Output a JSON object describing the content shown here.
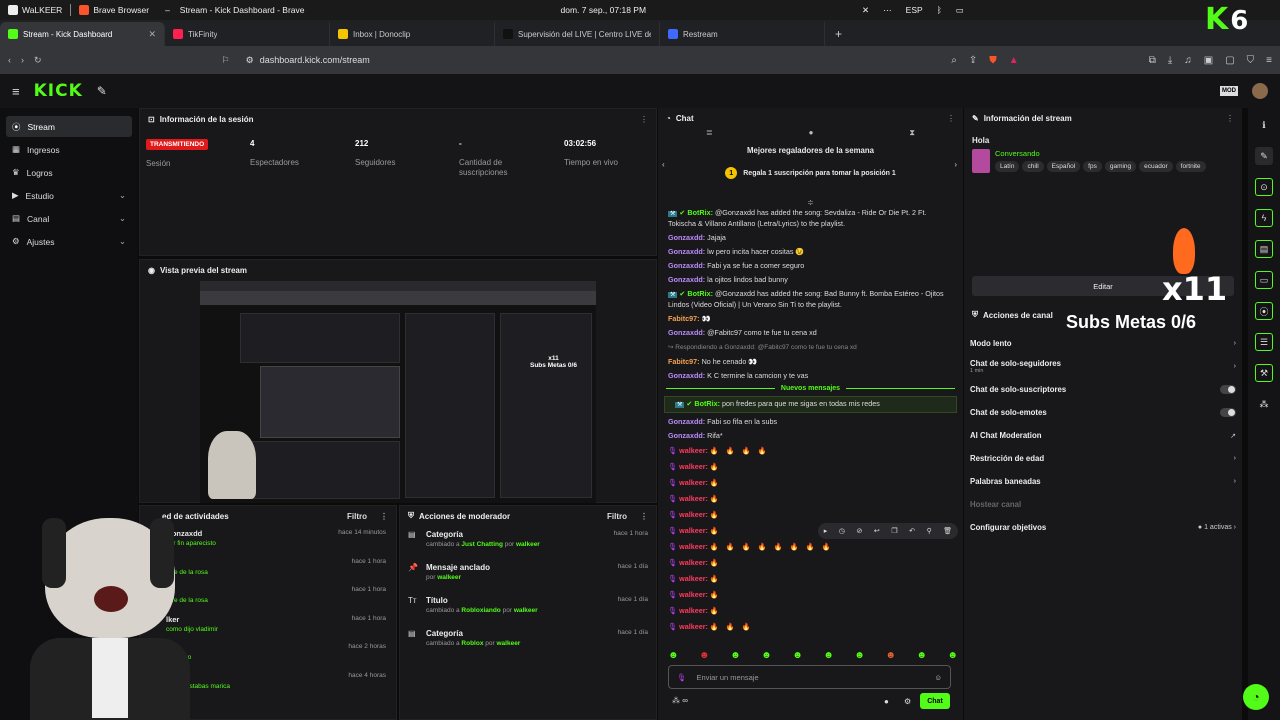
{
  "system": {
    "app": "WaLKEER",
    "browser": "Brave Browser",
    "window_title": "Stream - Kick Dashboard - Brave",
    "clock": "dom. 7 sep., 07:18 PM",
    "lang": "ESP"
  },
  "tabs": [
    {
      "label": "Stream - Kick Dashboard",
      "color": "#53fc18"
    },
    {
      "label": "TikFinity",
      "color": "#ff2050"
    },
    {
      "label": "Inbox | Donoclip",
      "color": "#f5c400"
    },
    {
      "label": "Supervisión del LIVE | Centro LIVE de",
      "color": "#111"
    },
    {
      "label": "Restream",
      "color": "#3d6bff"
    }
  ],
  "url": "dashboard.kick.com/stream",
  "logo": "KICK",
  "sidebar": [
    {
      "label": "Stream"
    },
    {
      "label": "Ingresos"
    },
    {
      "label": "Logros"
    },
    {
      "label": "Estudio"
    },
    {
      "label": "Canal"
    },
    {
      "label": "Ajustes"
    }
  ],
  "session": {
    "title": "Información de la sesión",
    "live_badge": "TRANSMITIENDO",
    "session_label": "Sesión",
    "viewers": "4",
    "viewers_label": "Espectadores",
    "followers": "212",
    "followers_label": "Seguidores",
    "subs": "-",
    "subs_label": "Cantidad de suscripciones",
    "time": "03:02:56",
    "time_label": "Tiempo en vivo"
  },
  "preview": {
    "title": "Vista previa del stream"
  },
  "activity": {
    "title": "ed de actividades",
    "filter": "Filtro",
    "rows": [
      {
        "user": "Gonzaxdd",
        "detail": "por fin aparecisto",
        "time": "hace 14 minutos"
      },
      {
        "user": "er",
        "detail": "Aire de la rosa",
        "time": "hace 1 hora"
      },
      {
        "user": "er",
        "detail": "Aire de la rosa",
        "time": "hace 1 hora"
      },
      {
        "user": "lker",
        "detail": "como dijo vladimir",
        "time": "hace 1 hora"
      },
      {
        "user": "er",
        "detail": "El huevo",
        "time": "hace 2 horas"
      },
      {
        "user": "er",
        "detail": "donde estabas marica",
        "time": "hace 4 horas"
      }
    ]
  },
  "mod": {
    "title": "Acciones de moderador",
    "filter": "Filtro",
    "rows": [
      {
        "icon": "▤",
        "title": "Categoría",
        "pre": "cambiado a",
        "value": "Just Chatting",
        "by": "por",
        "user": "walkeer",
        "time": "hace 1 hora"
      },
      {
        "icon": "📌",
        "title": "Mensaje anclado",
        "pre": "",
        "value": "",
        "by": "por",
        "user": "walkeer",
        "time": "hace 1 día"
      },
      {
        "icon": "Tт",
        "title": "Título",
        "pre": "cambiado a",
        "value": "Robloxiando",
        "by": "por",
        "user": "walkeer",
        "time": "hace 1 día"
      },
      {
        "icon": "▤",
        "title": "Categoría",
        "pre": "cambiado a",
        "value": "Roblox",
        "by": "por",
        "user": "walkeer",
        "time": "hace 1 día"
      }
    ]
  },
  "chat": {
    "title": "Chat",
    "gifters_title": "Mejores regaladores de la semana",
    "gifters_rank": "1",
    "gifters_cta": "Regala 1 suscripción para tomar la posición 1",
    "new_messages": "Nuevos mensajes",
    "input_placeholder": "Enviar un mensaje",
    "send": "Chat",
    "messages": [
      {
        "user": "BotRix:",
        "cls": "ug",
        "bot": true,
        "text": "@Gonzaxdd has added the song: Sevdaliza - Ride Or Die Pt. 2 Ft. Tokischa & Villano Antillano (Letra/Lyrics) to the playlist."
      },
      {
        "user": "Gonzaxdd:",
        "cls": "u1",
        "text": "Jajaja"
      },
      {
        "user": "Gonzaxdd:",
        "cls": "u1",
        "text": "lw pero incita hacer cositas 😉"
      },
      {
        "user": "Gonzaxdd:",
        "cls": "u1",
        "text": "Fabi ya se fue a comer seguro"
      },
      {
        "user": "Gonzaxdd:",
        "cls": "u1",
        "text": "la ojitos lindos bad bunny"
      },
      {
        "user": "BotRix:",
        "cls": "ug",
        "bot": true,
        "text": "@Gonzaxdd has added the song: Bad Bunny ft. Bomba Estéreo - Ojitos Lindos (Video Oficial) | Un Verano Sin Ti to the playlist."
      },
      {
        "user": "Fabitc97:",
        "cls": "u2",
        "text": "👀"
      },
      {
        "user": "Gonzaxdd:",
        "cls": "u1",
        "text": "@Fabitc97 como te fue tu cena xd"
      },
      {
        "user": "↪ Respondiendo a Gonzaxdd: @Fabitc97 como te fue tu cena xd",
        "cls": "reply",
        "text": ""
      },
      {
        "user": "Fabitc97:",
        "cls": "u2",
        "text": "No he cenado 👀"
      },
      {
        "user": "Gonzaxdd:",
        "cls": "u1",
        "text": "K C termine la camcion y te vas"
      }
    ],
    "messages_after": [
      {
        "user": "BotRix:",
        "cls": "ug",
        "bot": true,
        "text": "pon fredes para que me sigas en todas mis redes"
      },
      {
        "user": "Gonzaxdd:",
        "cls": "u1",
        "text": "Fabi so fifa en la subs"
      },
      {
        "user": "Gonzaxdd:",
        "cls": "u1",
        "text": "Rifa*"
      }
    ],
    "walkeer": "walkeer:",
    "flames": [
      4,
      1,
      1,
      1,
      1,
      1,
      8,
      1,
      1,
      1,
      1,
      3
    ]
  },
  "overlay": {
    "x": "x11",
    "subs": "Subs Metas 0/6",
    "kick": "K",
    "kick_num": "6"
  },
  "stream_info": {
    "title": "Información del stream",
    "stream_title": "Hola",
    "category": "Conversando",
    "tags": [
      "Latín",
      "chill",
      "Español",
      "fps",
      "gaming",
      "ecuador",
      "fortnite"
    ],
    "edit": "Editar"
  },
  "channel_actions": {
    "title": "Acciones de canal",
    "rows": [
      {
        "label": "Modo lento",
        "right": "›"
      },
      {
        "label": "Chat de solo-seguidores",
        "sub": "1 min",
        "right": "›"
      },
      {
        "label": "Chat de solo-suscriptores",
        "toggle": true
      },
      {
        "label": "Chat de solo-emotes",
        "toggle": true
      },
      {
        "label": "AI Chat Moderation",
        "right": "↗"
      },
      {
        "label": "Restricción de edad",
        "right": "›"
      },
      {
        "label": "Palabras baneadas",
        "right": "›"
      },
      {
        "label": "Hostear canal",
        "muted": true
      },
      {
        "label": "Configurar objetivos",
        "right": "● 1 activas ›"
      }
    ]
  }
}
